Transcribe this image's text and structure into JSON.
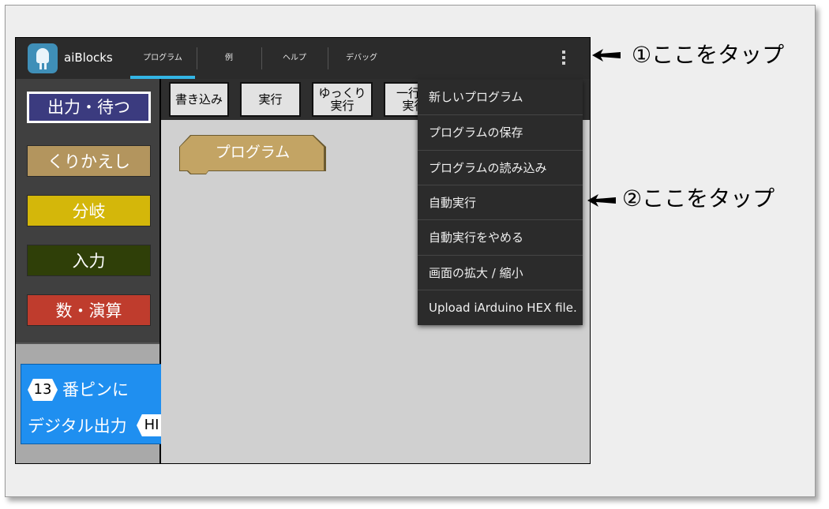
{
  "app": {
    "title": "aiBlocks"
  },
  "tabs": [
    {
      "label": "プログラム",
      "active": true
    },
    {
      "label": "例"
    },
    {
      "label": "ヘルプ"
    },
    {
      "label": "デバッグ"
    }
  ],
  "palette": {
    "categories": [
      {
        "label": "出力・待つ",
        "color": "#3b3b7f",
        "selected": true
      },
      {
        "label": "くりかえし",
        "color": "#b3955e"
      },
      {
        "label": "分岐",
        "color": "#d4b70a"
      },
      {
        "label": "入力",
        "color": "#2f3f08"
      },
      {
        "label": "数・演算",
        "color": "#bf3c2d"
      }
    ],
    "block": {
      "pin": "13",
      "line1": "番ピンに",
      "line2": "デジタル出力",
      "value": "HI"
    }
  },
  "toolbar": {
    "buttons": [
      {
        "label": "書き込み"
      },
      {
        "label": "実行"
      },
      {
        "label": "ゆっくり\n実行"
      },
      {
        "label": "一行ず\n実行"
      }
    ]
  },
  "workspace": {
    "program_block": "プログラム"
  },
  "menu": {
    "items": [
      "新しいプログラム",
      "プログラムの保存",
      "プログラムの読み込み",
      "自動実行",
      "自動実行をやめる",
      "画面の拡大 / 縮小",
      "Upload iArduino HEX file."
    ]
  },
  "annotations": {
    "step1": "①ここをタップ",
    "step2": "②ここをタップ"
  },
  "colors": {
    "accent": "#33b5e5",
    "block_blue": "#1f8ff0",
    "program_block": "#c3a464"
  }
}
